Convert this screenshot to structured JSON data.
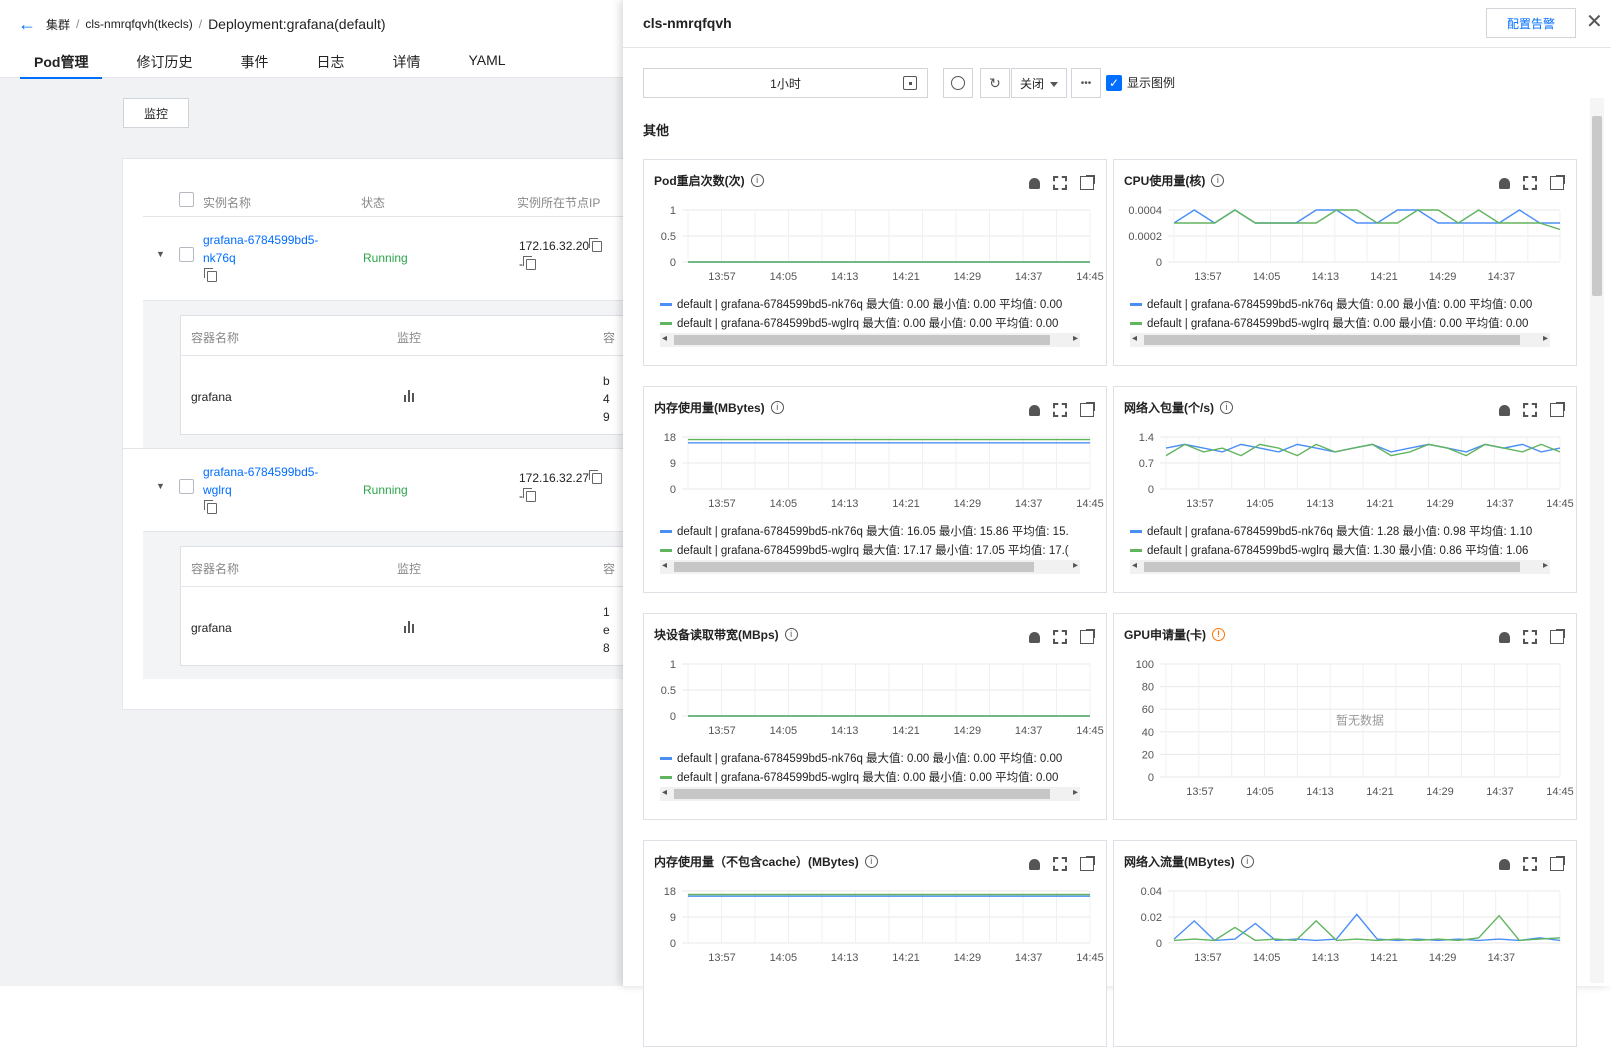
{
  "breadcrumb": {
    "cluster": "集群",
    "cluster_id": "cls-nmrqfqvh(tkecls)",
    "deployment": "Deployment:grafana(default)"
  },
  "tabs": [
    "Pod管理",
    "修订历史",
    "事件",
    "日志",
    "详情",
    "YAML"
  ],
  "monitor_button": "监控",
  "pod_table": {
    "headers": {
      "name": "实例名称",
      "status": "状态",
      "node_ip": "实例所在节点IP"
    },
    "container_headers": {
      "name": "容器名称",
      "monitor": "监控",
      "extra": "容"
    },
    "pods": [
      {
        "name_line1": "grafana-6784599bd5-",
        "name_line2": "nk76q",
        "status": "Running",
        "ip": "172.16.32.20",
        "ip2": "-",
        "container": "grafana",
        "cut": [
          "b",
          "4",
          "9"
        ]
      },
      {
        "name_line1": "grafana-6784599bd5-",
        "name_line2": "wglrq",
        "status": "Running",
        "ip": "172.16.32.27",
        "ip2": "-",
        "container": "grafana",
        "cut": [
          "1",
          "e",
          "8"
        ]
      }
    ]
  },
  "panel": {
    "title": "cls-nmrqfqvh",
    "alarm_button": "配置告警",
    "close": "✕",
    "time_range": "1小时",
    "refresh_select": "关闭",
    "more": "•••",
    "legend_toggle": "显示图例",
    "section": "其他"
  },
  "colors": {
    "blue": "#4b8ff5",
    "green": "#62b45f",
    "accent": "#006eff",
    "grid": "#e8e8e8"
  },
  "chart_data": [
    {
      "title": "Pod重启次数(次)",
      "type": "line",
      "x": [
        "13:57",
        "14:05",
        "14:13",
        "14:21",
        "14:29",
        "14:37",
        "14:45"
      ],
      "yticks": [
        "1",
        "0.5",
        "0"
      ],
      "ylim": [
        0,
        1
      ],
      "series": [
        {
          "name": "default | grafana-6784599bd5-nk76q",
          "values": [
            0,
            0,
            0,
            0,
            0,
            0,
            0
          ]
        },
        {
          "name": "default | grafana-6784599bd5-wglrq",
          "values": [
            0,
            0,
            0,
            0,
            0,
            0,
            0
          ]
        }
      ],
      "legend": [
        "default | grafana-6784599bd5-nk76q 最大值: 0.00 最小值: 0.00 平均值: 0.00",
        "default | grafana-6784599bd5-wglrq 最大值: 0.00 最小值: 0.00 平均值: 0.00"
      ]
    },
    {
      "title": "CPU使用量(核)",
      "type": "line",
      "x": [
        "13:57",
        "14:05",
        "14:13",
        "14:21",
        "14:29",
        "14:37"
      ],
      "yticks": [
        "0.0004",
        "0.0002",
        "0"
      ],
      "ylim": [
        0,
        0.0004
      ],
      "series": [
        {
          "name": "default | grafana-6784599bd5-nk76q",
          "values": [
            0.0003,
            0.0004,
            0.0003,
            0.0004,
            0.0003,
            0.0003,
            0.0003,
            0.0004,
            0.0004,
            0.0003,
            0.0003,
            0.0004,
            0.0004,
            0.0003,
            0.0003,
            0.0003,
            0.0003,
            0.0004,
            0.0003,
            0.0003
          ]
        },
        {
          "name": "default | grafana-6784599bd5-wglrq",
          "values": [
            0.0003,
            0.0003,
            0.0003,
            0.0004,
            0.0003,
            0.0003,
            0.0003,
            0.0003,
            0.0004,
            0.0004,
            0.0003,
            0.0003,
            0.0004,
            0.0004,
            0.0003,
            0.0004,
            0.0003,
            0.0003,
            0.0003,
            0.00025
          ]
        }
      ],
      "legend": [
        "default | grafana-6784599bd5-nk76q 最大值: 0.00 最小值: 0.00 平均值: 0.00",
        "default | grafana-6784599bd5-wglrq 最大值: 0.00 最小值: 0.00 平均值: 0.00"
      ]
    },
    {
      "title": "内存使用量(MBytes)",
      "type": "line",
      "x": [
        "13:57",
        "14:05",
        "14:13",
        "14:21",
        "14:29",
        "14:37",
        "14:45"
      ],
      "yticks": [
        "18",
        "9",
        "0"
      ],
      "ylim": [
        0,
        18
      ],
      "series": [
        {
          "name": "default | grafana-6784599bd5-nk76q",
          "values": [
            16,
            16,
            16,
            16,
            16,
            16,
            16,
            16,
            16,
            16
          ]
        },
        {
          "name": "default | grafana-6784599bd5-wglrq",
          "values": [
            17.1,
            17.1,
            17.1,
            17.1,
            17.1,
            17.1,
            17.1,
            17.1,
            17.1,
            17.1
          ]
        }
      ],
      "legend": [
        "default | grafana-6784599bd5-nk76q 最大值: 16.05 最小值: 15.86 平均值: 15.",
        "default | grafana-6784599bd5-wglrq 最大值: 17.17 最小值: 17.05 平均值: 17.("
      ]
    },
    {
      "title": "网络入包量(个/s)",
      "type": "line",
      "x": [
        "13:57",
        "14:05",
        "14:13",
        "14:21",
        "14:29",
        "14:37",
        "14:45"
      ],
      "yticks": [
        "1.4",
        "0.7",
        "0"
      ],
      "ylim": [
        0,
        1.4
      ],
      "series": [
        {
          "name": "default | grafana-6784599bd5-nk76q",
          "values": [
            1.1,
            1.2,
            1.1,
            1.0,
            1.2,
            1.1,
            1.0,
            1.2,
            1.1,
            1.0,
            1.1,
            1.2,
            1.0,
            1.1,
            1.2,
            1.1,
            1.0,
            1.2,
            1.1,
            1.2,
            1.0,
            1.1
          ]
        },
        {
          "name": "default | grafana-6784599bd5-wglrq",
          "values": [
            0.9,
            1.2,
            1.0,
            1.1,
            0.9,
            1.2,
            1.1,
            0.9,
            1.2,
            1.0,
            1.1,
            1.2,
            0.9,
            1.0,
            1.2,
            1.1,
            0.9,
            1.2,
            1.1,
            1.0,
            1.2,
            1.0
          ]
        }
      ],
      "legend": [
        "default | grafana-6784599bd5-nk76q 最大值: 1.28 最小值: 0.98 平均值: 1.10",
        "default | grafana-6784599bd5-wglrq 最大值: 1.30 最小值: 0.86 平均值: 1.06"
      ]
    },
    {
      "title": "块设备读取带宽(MBps)",
      "type": "line",
      "x": [
        "13:57",
        "14:05",
        "14:13",
        "14:21",
        "14:29",
        "14:37",
        "14:45"
      ],
      "yticks": [
        "1",
        "0.5",
        "0"
      ],
      "ylim": [
        0,
        1
      ],
      "series": [
        {
          "name": "default | grafana-6784599bd5-nk76q",
          "values": [
            0,
            0,
            0,
            0,
            0,
            0,
            0
          ]
        },
        {
          "name": "default | grafana-6784599bd5-wglrq",
          "values": [
            0,
            0,
            0,
            0,
            0,
            0,
            0
          ]
        }
      ],
      "legend": [
        "default | grafana-6784599bd5-nk76q 最大值: 0.00 最小值: 0.00 平均值: 0.00",
        "default | grafana-6784599bd5-wglrq 最大值: 0.00 最小值: 0.00 平均值: 0.00"
      ]
    },
    {
      "title": "GPU申请量(卡)",
      "type": "line",
      "warn": true,
      "x": [
        "13:57",
        "14:05",
        "14:13",
        "14:21",
        "14:29",
        "14:37",
        "14:45"
      ],
      "yticks": [
        "100",
        "80",
        "60",
        "40",
        "20",
        "0"
      ],
      "ylim": [
        0,
        100
      ],
      "series": [],
      "empty": "暂无数据",
      "legend": []
    },
    {
      "title": "内存使用量（不包含cache）(MBytes)",
      "type": "line",
      "x": [
        "13:57",
        "14:05",
        "14:13",
        "14:21",
        "14:29",
        "14:37",
        "14:45"
      ],
      "yticks": [
        "18",
        "9",
        "0"
      ],
      "ylim": [
        0,
        18
      ],
      "series": [
        {
          "name": "default | grafana-6784599bd5-nk76q",
          "values": [
            16.2,
            16.2,
            16.2,
            16.2,
            16.2,
            16.2,
            16.2
          ]
        },
        {
          "name": "default | grafana-6784599bd5-wglrq",
          "values": [
            16.8,
            16.8,
            16.8,
            16.8,
            16.8,
            16.8,
            16.8
          ]
        }
      ],
      "legend": []
    },
    {
      "title": "网络入流量(MBytes)",
      "type": "line",
      "x": [
        "13:57",
        "14:05",
        "14:13",
        "14:21",
        "14:29",
        "14:37"
      ],
      "yticks": [
        "0.04",
        "0.02",
        "0"
      ],
      "ylim": [
        0,
        0.04
      ],
      "series": [
        {
          "name": "default | grafana-6784599bd5-nk76q",
          "values": [
            0.003,
            0.017,
            0.002,
            0.003,
            0.015,
            0.002,
            0.003,
            0.002,
            0.003,
            0.022,
            0.003,
            0.002,
            0.003,
            0.002,
            0.003,
            0.002,
            0.003,
            0.002,
            0.004,
            0.002
          ]
        },
        {
          "name": "default | grafana-6784599bd5-wglrq",
          "values": [
            0.002,
            0.003,
            0.002,
            0.012,
            0.002,
            0.003,
            0.002,
            0.017,
            0.002,
            0.003,
            0.002,
            0.003,
            0.002,
            0.003,
            0.002,
            0.004,
            0.021,
            0.002,
            0.003,
            0.004
          ]
        }
      ],
      "legend": []
    }
  ]
}
